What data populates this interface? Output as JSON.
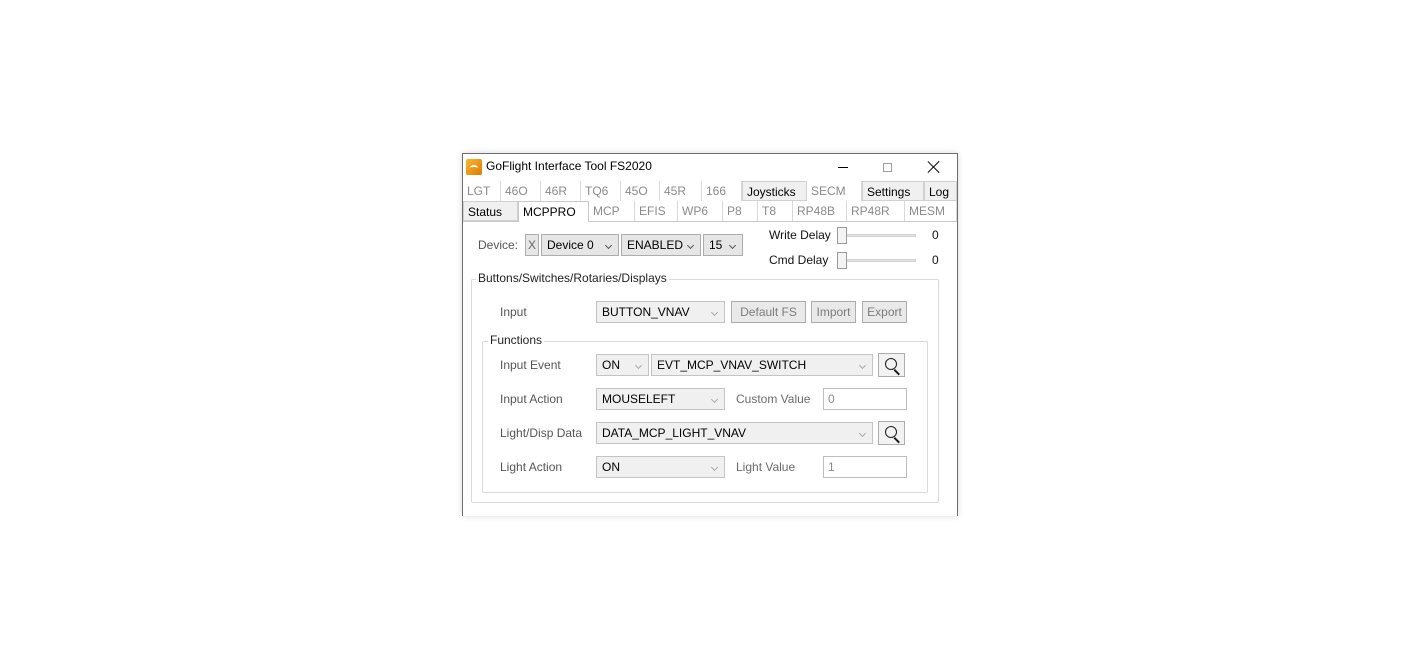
{
  "window": {
    "title": "GoFlight Interface Tool FS2020"
  },
  "tabs_row1": [
    "LGT",
    "46O",
    "46R",
    "TQ6",
    "45O",
    "45R",
    "166",
    "Joysticks",
    "SECM",
    "Settings",
    "Log"
  ],
  "tabs_row2": [
    "Status",
    "MCPPRO",
    "MCP",
    "EFIS",
    "WP6",
    "P8",
    "T8",
    "RP48B",
    "RP48R",
    "MESM"
  ],
  "selected_tab": "MCPPRO",
  "device": {
    "label": "Device:",
    "x_button": "X",
    "device_select": "Device 0",
    "state_select": "ENABLED",
    "number_select": "15"
  },
  "delays": {
    "write_label": "Write Delay",
    "write_value": "0",
    "write_level": 0,
    "cmd_label": "Cmd Delay",
    "cmd_value": "0",
    "cmd_level": 0
  },
  "group": {
    "title": "Buttons/Switches/Rotaries/Displays",
    "input_label": "Input",
    "input_select": "BUTTON_VNAV",
    "default_button": "Default FS",
    "import_button": "Import",
    "export_button": "Export"
  },
  "functions": {
    "title": "Functions",
    "input_event_label": "Input Event",
    "input_event_state": "ON",
    "input_event_value": "EVT_MCP_VNAV_SWITCH",
    "input_action_label": "Input Action",
    "input_action_value": "MOUSELEFT",
    "custom_value_label": "Custom Value",
    "custom_value": "0",
    "light_data_label": "Light/Disp Data",
    "light_data_value": "DATA_MCP_LIGHT_VNAV",
    "light_action_label": "Light Action",
    "light_action_value": "ON",
    "light_value_label": "Light Value",
    "light_value": "1"
  },
  "icons": {
    "app": "goflight-app-icon",
    "search": "search-icon",
    "minimize": "minimize-icon",
    "maximize": "maximize-icon",
    "close": "close-icon"
  }
}
